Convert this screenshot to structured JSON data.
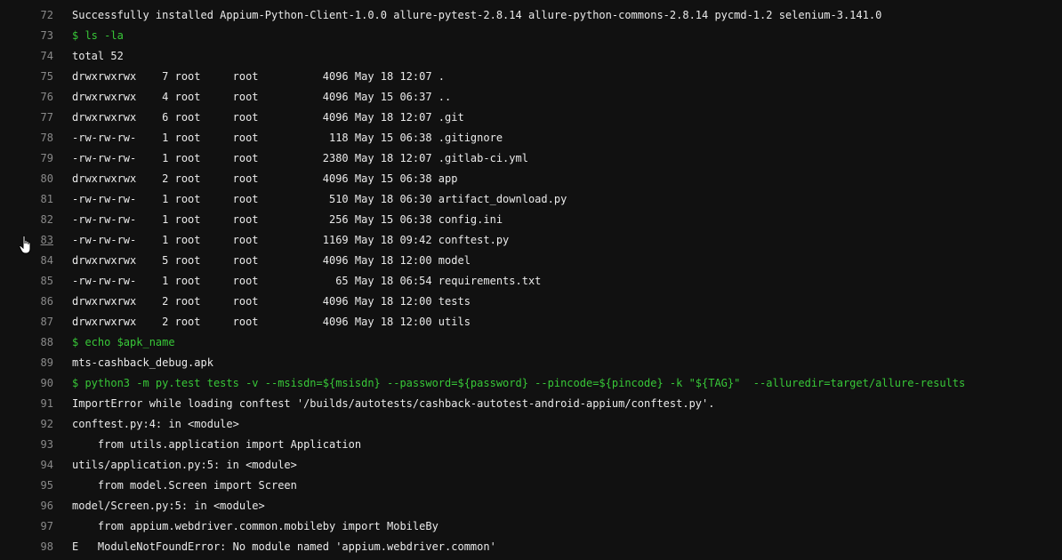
{
  "colors": {
    "background": "#111111",
    "text": "#eaeaea",
    "command": "#38c838",
    "line_number": "#8a8a8a"
  },
  "cursor_icon": "hand-pointer-icon",
  "lines": [
    {
      "n": "72",
      "text": "Successfully installed Appium-Python-Client-1.0.0 allure-pytest-2.8.14 allure-python-commons-2.8.14 pycmd-1.2 selenium-3.141.0",
      "cmd": false
    },
    {
      "n": "73",
      "text": "$ ls -la",
      "cmd": true
    },
    {
      "n": "74",
      "text": "total 52",
      "cmd": false
    },
    {
      "n": "75",
      "text": "drwxrwxrwx    7 root     root          4096 May 18 12:07 .",
      "cmd": false
    },
    {
      "n": "76",
      "text": "drwxrwxrwx    4 root     root          4096 May 15 06:37 ..",
      "cmd": false
    },
    {
      "n": "77",
      "text": "drwxrwxrwx    6 root     root          4096 May 18 12:07 .git",
      "cmd": false
    },
    {
      "n": "78",
      "text": "-rw-rw-rw-    1 root     root           118 May 15 06:38 .gitignore",
      "cmd": false
    },
    {
      "n": "79",
      "text": "-rw-rw-rw-    1 root     root          2380 May 18 12:07 .gitlab-ci.yml",
      "cmd": false
    },
    {
      "n": "80",
      "text": "drwxrwxrwx    2 root     root          4096 May 15 06:38 app",
      "cmd": false
    },
    {
      "n": "81",
      "text": "-rw-rw-rw-    1 root     root           510 May 18 06:30 artifact_download.py",
      "cmd": false
    },
    {
      "n": "82",
      "text": "-rw-rw-rw-    1 root     root           256 May 15 06:38 config.ini",
      "cmd": false
    },
    {
      "n": "83",
      "text": "-rw-rw-rw-    1 root     root          1169 May 18 09:42 conftest.py",
      "cmd": false
    },
    {
      "n": "84",
      "text": "drwxrwxrwx    5 root     root          4096 May 18 12:00 model",
      "cmd": false
    },
    {
      "n": "85",
      "text": "-rw-rw-rw-    1 root     root            65 May 18 06:54 requirements.txt",
      "cmd": false
    },
    {
      "n": "86",
      "text": "drwxrwxrwx    2 root     root          4096 May 18 12:00 tests",
      "cmd": false
    },
    {
      "n": "87",
      "text": "drwxrwxrwx    2 root     root          4096 May 18 12:00 utils",
      "cmd": false
    },
    {
      "n": "88",
      "text": "$ echo $apk_name",
      "cmd": true
    },
    {
      "n": "89",
      "text": "mts-cashback_debug.apk",
      "cmd": false
    },
    {
      "n": "90",
      "text": "$ python3 -m py.test tests -v --msisdn=${msisdn} --password=${password} --pincode=${pincode} -k \"${TAG}\"  --alluredir=target/allure-results",
      "cmd": true
    },
    {
      "n": "91",
      "text": "ImportError while loading conftest '/builds/autotests/cashback-autotest-android-appium/conftest.py'.",
      "cmd": false
    },
    {
      "n": "92",
      "text": "conftest.py:4: in <module>",
      "cmd": false
    },
    {
      "n": "93",
      "text": "    from utils.application import Application",
      "cmd": false
    },
    {
      "n": "94",
      "text": "utils/application.py:5: in <module>",
      "cmd": false
    },
    {
      "n": "95",
      "text": "    from model.Screen import Screen",
      "cmd": false
    },
    {
      "n": "96",
      "text": "model/Screen.py:5: in <module>",
      "cmd": false
    },
    {
      "n": "97",
      "text": "    from appium.webdriver.common.mobileby import MobileBy",
      "cmd": false
    },
    {
      "n": "98",
      "text": "E   ModuleNotFoundError: No module named 'appium.webdriver.common'",
      "cmd": false
    }
  ]
}
